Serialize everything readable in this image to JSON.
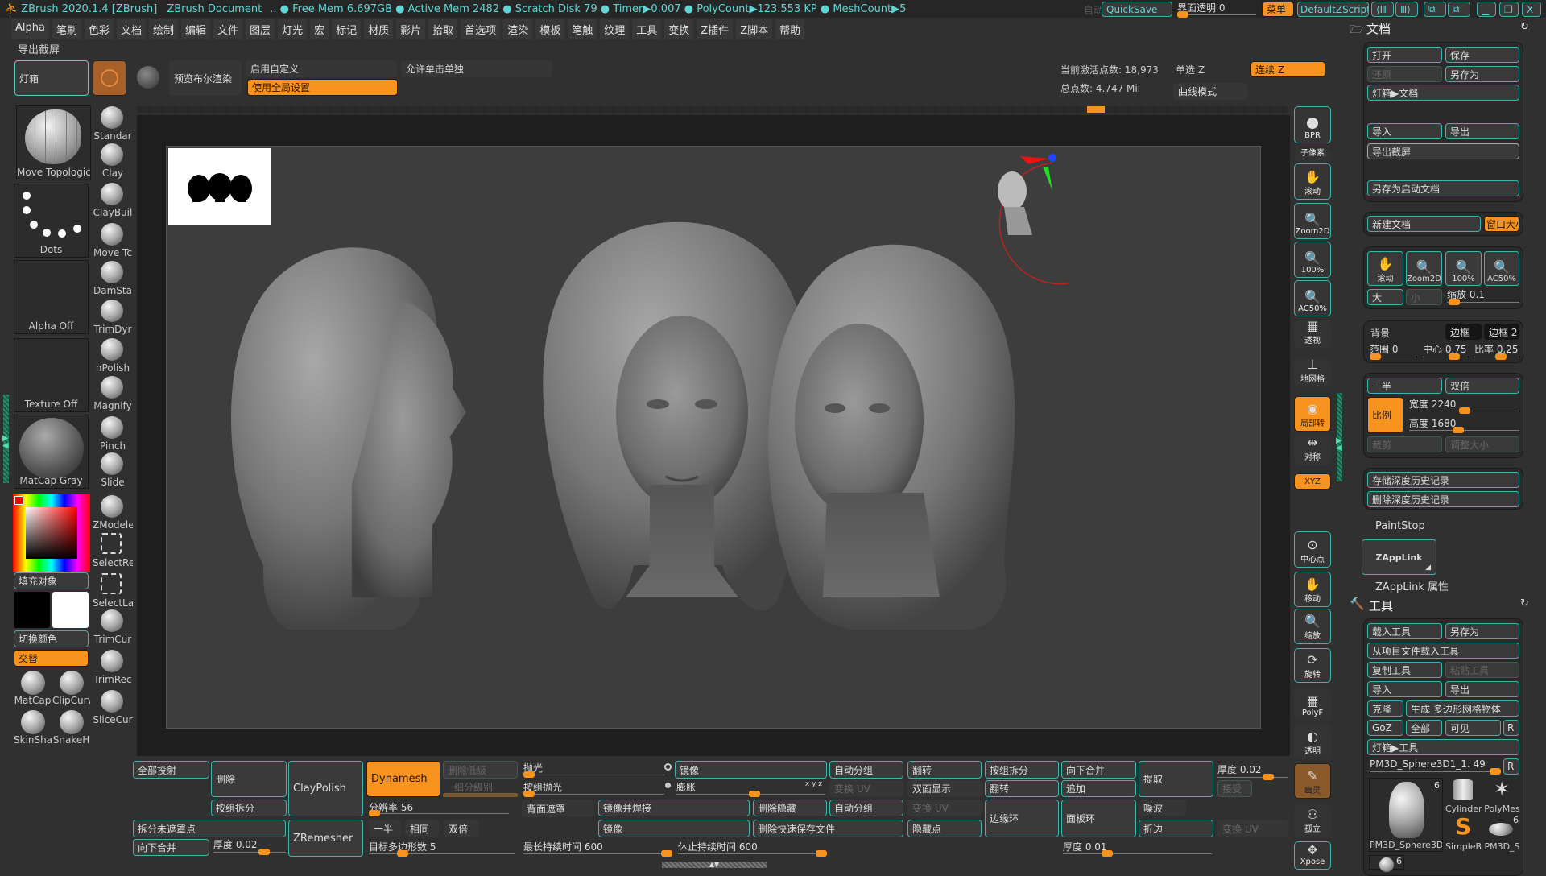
{
  "title_bar": {
    "app": "ZBrush 2020.1.4 [ZBrush]",
    "document": "ZBrush Document",
    "status": ".. ● Free Mem 6.697GB ● Active Mem 2482 ● Scratch Disk 79 ● Timer▶0.007 ● PolyCount▶123.553 KP ● MeshCount▶5",
    "auto": "自动",
    "quicksave": "QuickSave",
    "ui_transparency": "界面透明 0",
    "menu": "菜单",
    "script": "DefaultZScript"
  },
  "menu": [
    "Alpha",
    "笔刷",
    "色彩",
    "文档",
    "绘制",
    "编辑",
    "文件",
    "图层",
    "灯光",
    "宏",
    "标记",
    "材质",
    "影片",
    "拾取",
    "首选项",
    "渲染",
    "模板",
    "笔触",
    "纹理",
    "工具",
    "变换",
    "Z插件",
    "Z脚本",
    "帮助"
  ],
  "palette_title": "导出截屏",
  "top_shelf": {
    "lightbox": "灯箱",
    "bool_preview": "预览布尔渲染",
    "enable_custom": "启用自定义",
    "use_global": "使用全局设置",
    "allow_click_solo": "允许单击单独",
    "active_points": "当前激活点数: 18,973",
    "total_points": "总点数: 4.747 Mil",
    "single_z": "单选 Z",
    "continuous_z": "连续 Z",
    "curve_mode": "曲线模式"
  },
  "left_tray": {
    "brush": "Move Topologica",
    "stroke": "Dots",
    "alpha": "Alpha Off",
    "texture": "Texture Off",
    "material": "MatCap Gray",
    "fill_object": "填充对象",
    "switch_color": "切换颜色",
    "alternate": "交替",
    "brushes": [
      "Standar",
      "Clay",
      "ClayBuil",
      "Move Tc",
      "DamSta",
      "TrimDyr",
      "hPolish",
      "Magnify",
      "Pinch",
      "Slide",
      "ZModele",
      "SelectRe",
      "SelectLa",
      "TrimCur",
      "TrimRec",
      "SliceCur"
    ],
    "materials": [
      "MatCap",
      "ClipCurv",
      "SkinSha",
      "SnakeH"
    ]
  },
  "right_shelf": [
    "BPR",
    "子像素",
    "滚动",
    "Zoom2D",
    "100%",
    "AC50%",
    "透视",
    "地网格",
    "局部转",
    "对称",
    "XYZ",
    "中心点",
    "移动",
    "缩放",
    "旋转",
    "PolyF",
    "透明",
    "幽灵",
    "孤立",
    "Xpose"
  ],
  "document_panel": {
    "title": "文档",
    "open": "打开",
    "save": "保存",
    "revert": "还原",
    "save_as": "另存为",
    "lightbox_doc": "灯箱▶文档",
    "import": "导入",
    "export": "导出",
    "export_screen": "导出截屏",
    "save_startup": "另存为启动文档",
    "new_doc": "新建文档",
    "window_size": "窗口大小",
    "nav": [
      "滚动",
      "Zoom2D",
      "100%",
      "AC50%"
    ],
    "large": "大",
    "small": "小",
    "zoom": "缩放 0.1",
    "back": "背景",
    "border": "边框",
    "border2": "边框 2",
    "range": "范围 0",
    "center": "中心 0.75",
    "rate": "比率 0.25",
    "half": "一半",
    "double": "双倍",
    "ratio": "比例",
    "width": "宽度 2240",
    "height": "高度 1680",
    "crop": "裁剪",
    "resize": "调整大小",
    "store_depth": "存储深度历史记录",
    "delete_depth": "删除深度历史记录"
  },
  "paintstop": "PaintStop",
  "zapplink": "ZAppLink",
  "zapplink_props": "ZAppLink 属性",
  "tool_panel": {
    "title": "工具",
    "load": "载入工具",
    "save_as": "另存为",
    "load_project": "从项目文件载入工具",
    "copy": "复制工具",
    "paste": "粘贴工具",
    "import": "导入",
    "export": "导出",
    "clone": "克隆",
    "make_polymesh": "生成 多边形网格物体",
    "goz": "GoZ",
    "all": "全部",
    "visible": "可见",
    "r": "R",
    "lightbox_tool": "灯箱▶工具",
    "current_tool": "PM3D_Sphere3D1_1. 49",
    "thumbs": [
      {
        "label": "PM3D_Sphere3D",
        "count": "6"
      },
      {
        "label": "Cylinder"
      },
      {
        "label": "PolyMes"
      },
      {
        "label": "SimpleB"
      },
      {
        "label": "PM3D_S",
        "count": "6"
      },
      {
        "label": "",
        "count": "6"
      }
    ]
  },
  "bottom": {
    "project_all": "全部投射",
    "delete": "删除",
    "split_groups": "按组拆分",
    "claypolish": "ClayPolish",
    "dynamesh": "Dynamesh",
    "del_lower": "删除低级",
    "subdiv_level": "细分级别",
    "resolution": "分辨率 56",
    "split_unmasked": "拆分未遮罩点",
    "merge_down": "向下合并",
    "thickness1": "厚度 0.02",
    "zremesher": "ZRemesher",
    "half": "一半",
    "same": "相同",
    "double": "双倍",
    "target_polys": "目标多边形数 5",
    "polish": "抛光",
    "group_polish": "按组抛光",
    "backface_mask": "背面遮罩",
    "mirror": "镜像",
    "inflate": "膨胀",
    "mirror_weld": "镜像并焊接",
    "mirror2": "镜像",
    "del_hidden": "删除隐藏",
    "del_quicksave": "删除快速保存文件",
    "max_duration": "最长持续时间 600",
    "rest_duration": "休止持续时间 600",
    "auto_group": "自动分组",
    "uv_swap": "变换 UV",
    "auto_group2": "自动分组",
    "flip": "翻转",
    "double_sided": "双面显示",
    "uv_swap2": "变换 UV",
    "hide_pts": "隐藏点",
    "split_groups2": "按组拆分",
    "flip2": "翻转",
    "edge_loop": "边缘环",
    "merge_down2": "向下合并",
    "append": "追加",
    "panel_loops": "面板环",
    "extract": "提取",
    "noise": "噪波",
    "crease": "折边",
    "thickness2": "厚度 0.01",
    "thickness3": "厚度 0.02",
    "accept": "接受",
    "uv_swap3": "变换 UV",
    "xyz": "x y z"
  },
  "colors": {
    "accent": "#f7931e",
    "outline": "#3bb5ad",
    "title_text": "#5fd6d6",
    "primary_color": "#000000",
    "secondary_color": "#ffffff"
  }
}
